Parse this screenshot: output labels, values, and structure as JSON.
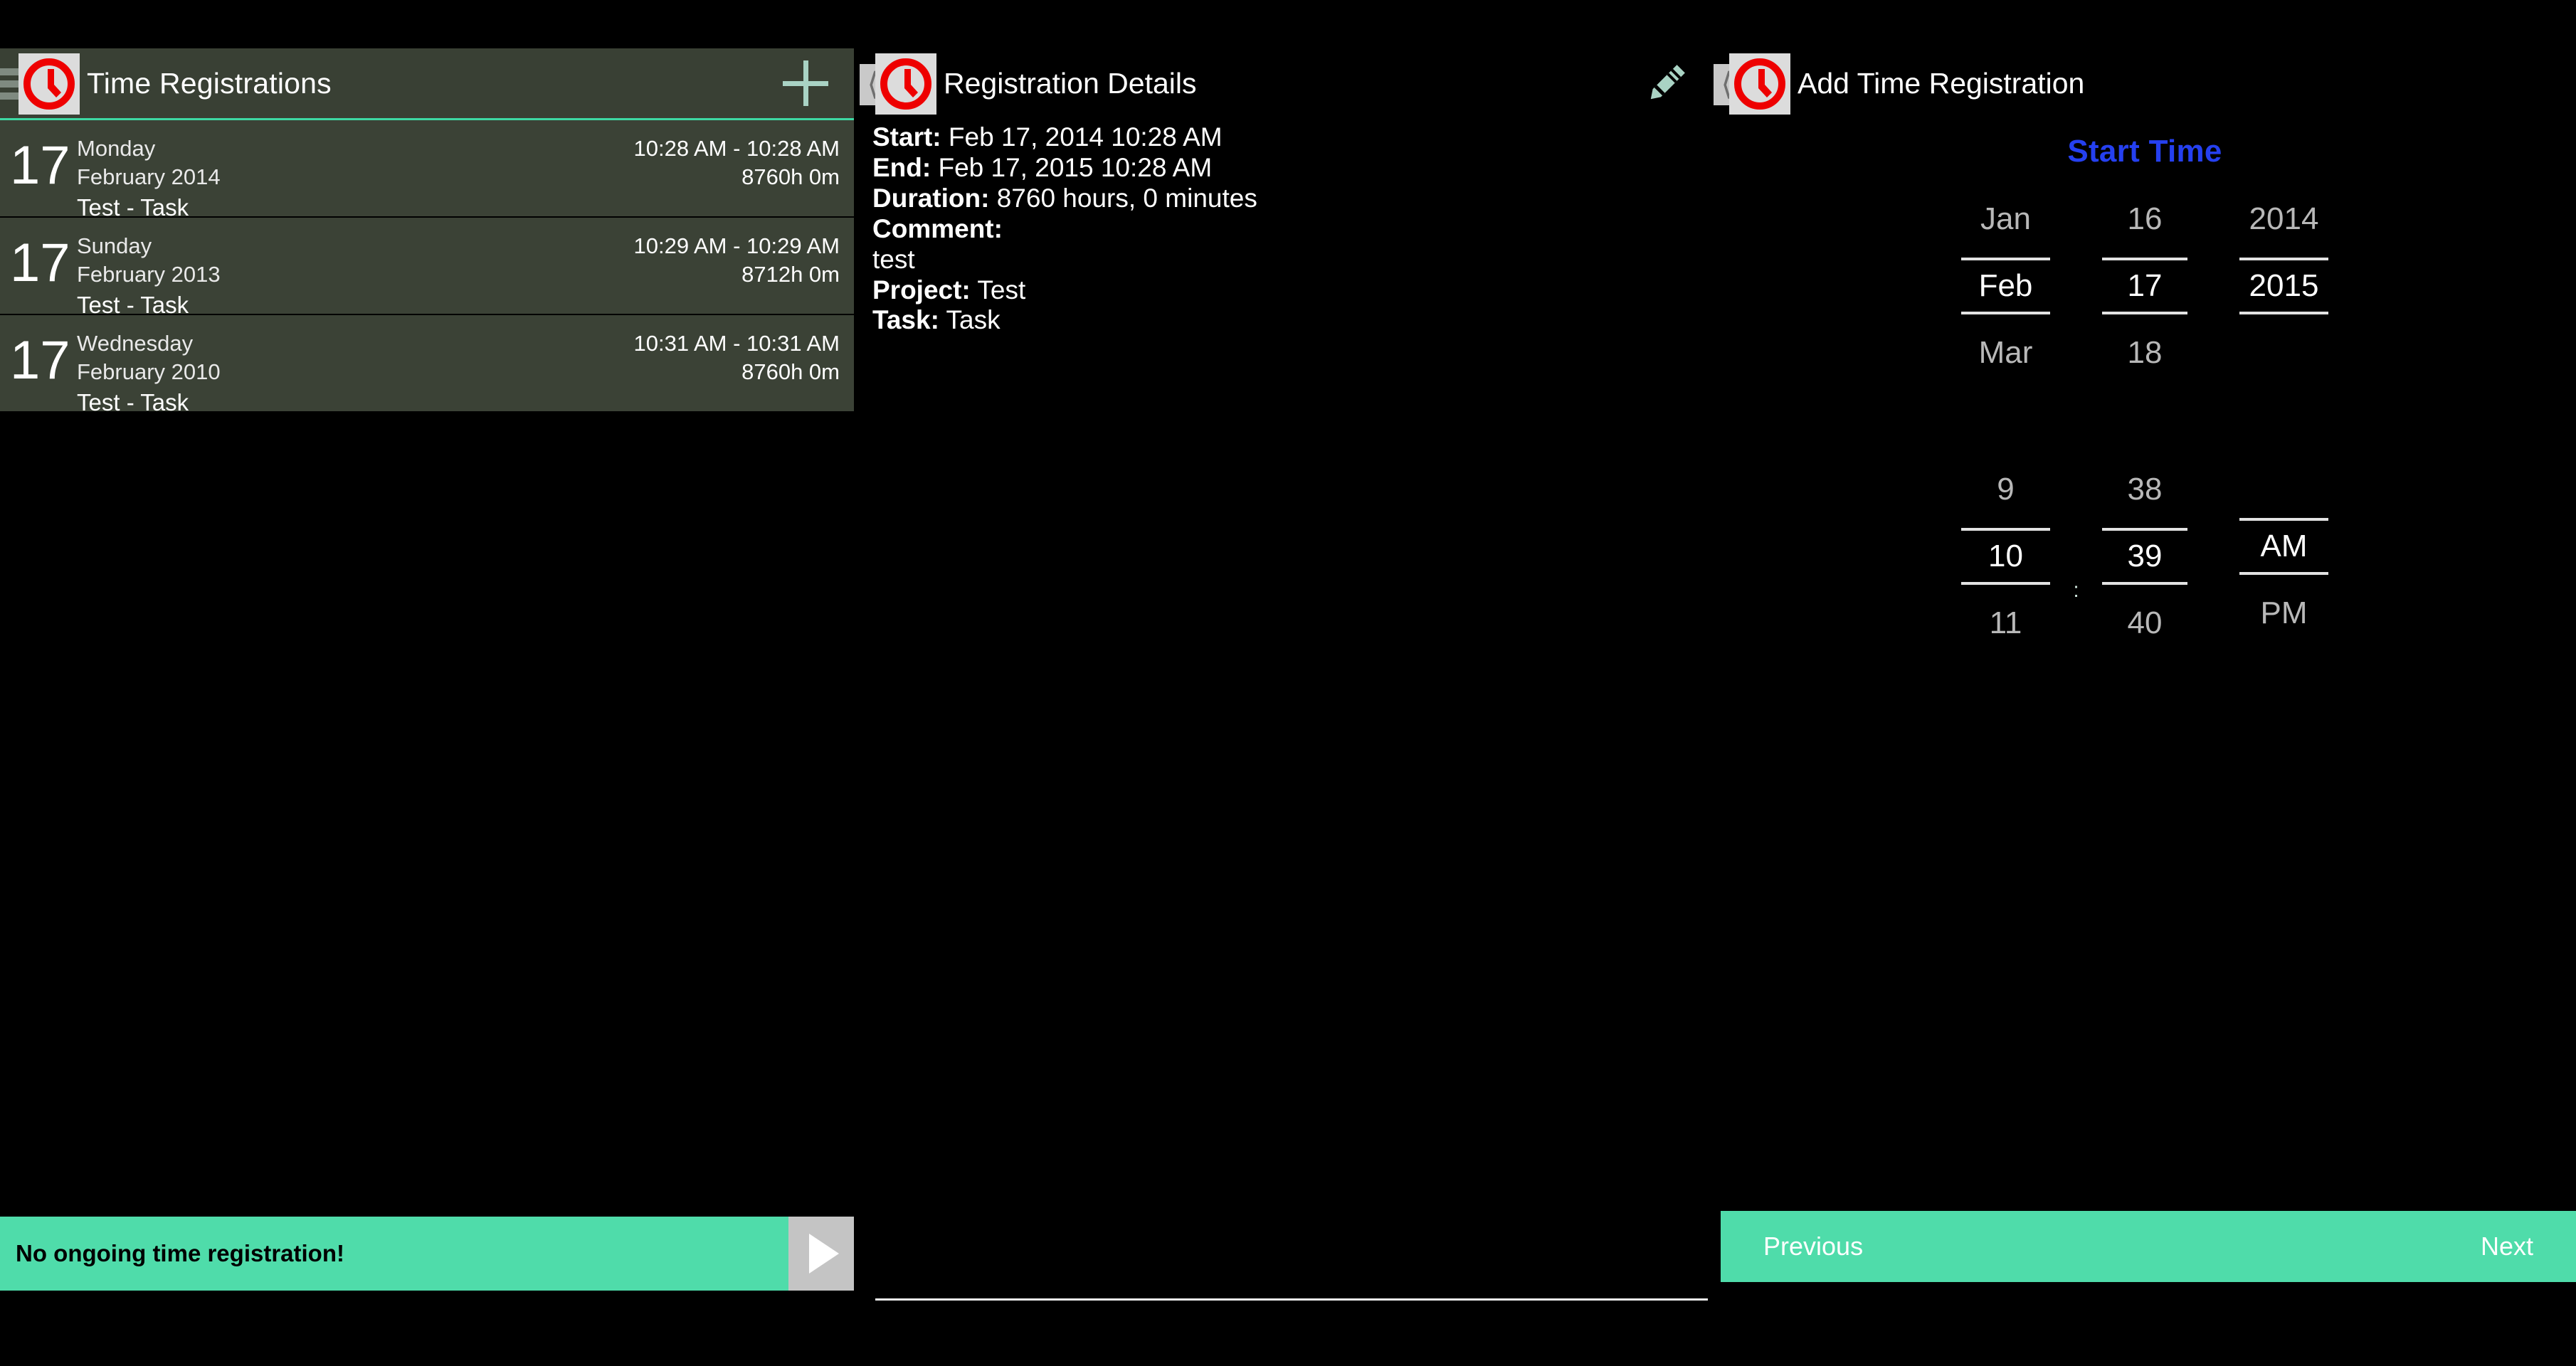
{
  "colors": {
    "panel_green": "#3b4236",
    "header_green": "#394034",
    "accent_teal": "#4fdcaa",
    "rule_teal": "#3ed9a3",
    "mint": "#a9d3c4",
    "clock_red": "#ee0000",
    "start_time_blue": "#2540f0",
    "background": "#000000"
  },
  "left_panel": {
    "title": "Time Registrations",
    "menu_icon": "hamburger-icon",
    "app_icon": "clock-icon",
    "add_icon": "plus-icon",
    "registrations": [
      {
        "day": "17",
        "weekday": "Monday",
        "month_year": "February 2014",
        "project_task": "Test - Task",
        "time_range": "10:28 AM - 10:28 AM",
        "duration": "8760h 0m"
      },
      {
        "day": "17",
        "weekday": "Sunday",
        "month_year": "February 2013",
        "project_task": "Test - Task",
        "time_range": "10:29 AM - 10:29 AM",
        "duration": "8712h 0m"
      },
      {
        "day": "17",
        "weekday": "Wednesday",
        "month_year": "February 2010",
        "project_task": "Test - Task",
        "time_range": "10:31 AM - 10:31 AM",
        "duration": "8760h 0m"
      }
    ],
    "status_bar": {
      "message": "No ongoing time registration!",
      "play_icon": "play-icon"
    }
  },
  "detail_panel": {
    "title": "Registration Details",
    "back_icon": "back-chevron-icon",
    "app_icon": "clock-icon",
    "edit_icon": "pencil-icon",
    "fields": {
      "start_label": "Start:",
      "start_value": "Feb 17, 2014 10:28 AM",
      "end_label": "End:",
      "end_value": "Feb 17, 2015 10:28 AM",
      "duration_label": "Duration:",
      "duration_value": "8760 hours, 0 minutes",
      "comment_label": "Comment:",
      "comment_value": "test",
      "project_label": "Project:",
      "project_value": "Test",
      "task_label": "Task:",
      "task_value": "Task"
    }
  },
  "add_panel": {
    "title": "Add Time Registration",
    "back_icon": "back-chevron-icon",
    "app_icon": "clock-icon",
    "section_title": "Start Time",
    "date_picker": {
      "month": {
        "previous": "Jan",
        "selected": "Feb",
        "next": "Mar"
      },
      "day": {
        "previous": "16",
        "selected": "17",
        "next": "18"
      },
      "year": {
        "previous": "2014",
        "selected": "2015",
        "next": ""
      }
    },
    "time_picker": {
      "hour": {
        "previous": "9",
        "selected": "10",
        "next": "11"
      },
      "separator": ":",
      "minute": {
        "previous": "38",
        "selected": "39",
        "next": "40"
      },
      "meridiem": {
        "previous": "",
        "selected": "AM",
        "next": "PM"
      }
    },
    "nav": {
      "previous_label": "Previous",
      "next_label": "Next"
    }
  }
}
